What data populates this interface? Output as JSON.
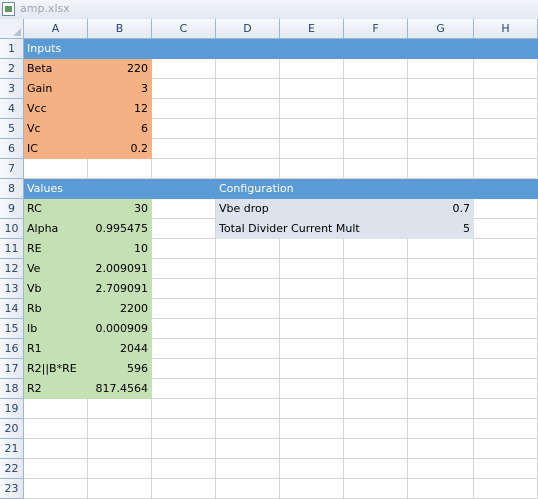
{
  "window": {
    "title": "amp.xlsx"
  },
  "columns": [
    "A",
    "B",
    "C",
    "D",
    "E",
    "F",
    "G",
    "H"
  ],
  "rows": [
    "1",
    "2",
    "3",
    "4",
    "5",
    "6",
    "7",
    "8",
    "9",
    "10",
    "11",
    "12",
    "13",
    "14",
    "15",
    "16",
    "17",
    "18",
    "19",
    "20",
    "21",
    "22",
    "23"
  ],
  "inputs": {
    "header": "Inputs",
    "items": [
      {
        "label": "Beta",
        "value": "220"
      },
      {
        "label": "Gain",
        "value": "3"
      },
      {
        "label": "Vcc",
        "value": "12"
      },
      {
        "label": "Vc",
        "value": "6"
      },
      {
        "label": "IC",
        "value": "0.2"
      }
    ]
  },
  "values": {
    "header": "Values",
    "items": [
      {
        "label": "RC",
        "value": "30"
      },
      {
        "label": "Alpha",
        "value": "0.995475"
      },
      {
        "label": "RE",
        "value": "10"
      },
      {
        "label": "Ve",
        "value": "2.009091"
      },
      {
        "label": "Vb",
        "value": "2.709091"
      },
      {
        "label": "Rb",
        "value": "2200"
      },
      {
        "label": "Ib",
        "value": "0.000909"
      },
      {
        "label": "R1",
        "value": "2044"
      },
      {
        "label": "R2||B*RE",
        "value": "596"
      },
      {
        "label": "R2",
        "value": "817.4564"
      }
    ]
  },
  "configuration": {
    "header": "Configuration",
    "items": [
      {
        "label": "Vbe drop",
        "value": "0.7"
      },
      {
        "label": "Total Divider Current Mult",
        "value": "5"
      }
    ]
  },
  "colors": {
    "header_band": "#5b9bd5",
    "inputs_fill": "#f4b183",
    "values_fill": "#c5e0b4",
    "config_fill": "#dce3ec"
  }
}
